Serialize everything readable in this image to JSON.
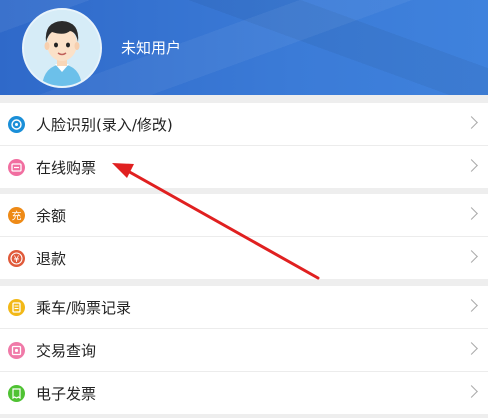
{
  "profile": {
    "username": "未知用户"
  },
  "groups": [
    {
      "items": [
        {
          "label": "人脸识别(录入/修改)",
          "icon": "face-recognition-icon",
          "color": "#1a8fd8"
        },
        {
          "label": "在线购票",
          "icon": "ticket-icon",
          "color": "#f16ea0"
        }
      ]
    },
    {
      "items": [
        {
          "label": "余额",
          "icon": "recharge-icon",
          "icon_text": "充",
          "color": "#ee8a16"
        },
        {
          "label": "退款",
          "icon": "refund-icon",
          "icon_text": "¥",
          "color": "#e05a3a"
        }
      ]
    },
    {
      "items": [
        {
          "label": "乘车/购票记录",
          "icon": "record-icon",
          "color": "#f2b817"
        },
        {
          "label": "交易查询",
          "icon": "transaction-query-icon",
          "color": "#f07aa8"
        },
        {
          "label": "电子发票",
          "icon": "invoice-icon",
          "color": "#4fc233"
        }
      ]
    }
  ],
  "annotation": {
    "arrow_color": "#e02020"
  }
}
